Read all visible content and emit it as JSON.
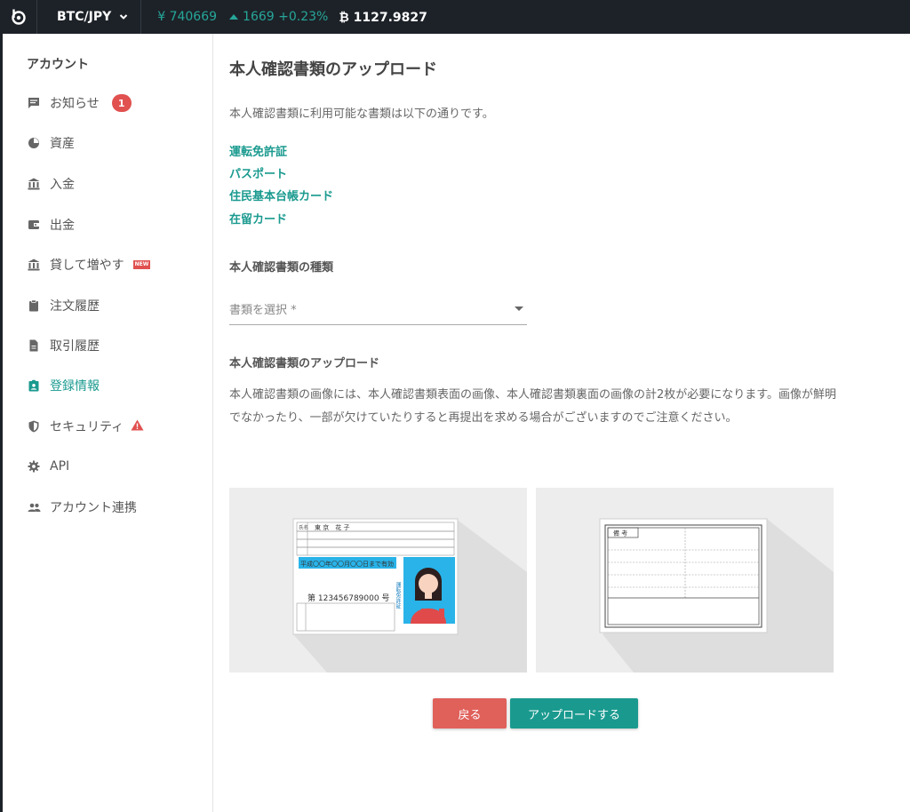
{
  "topbar": {
    "pair": "BTC/JPY",
    "price": "¥ 740669",
    "change": "1669 +0.23%",
    "volume": "₿ 1127.9827"
  },
  "sidebar": {
    "heading": "アカウント",
    "items": [
      {
        "label": "お知らせ",
        "icon": "message-icon",
        "badge": "1"
      },
      {
        "label": "資産",
        "icon": "pie-chart-icon"
      },
      {
        "label": "入金",
        "icon": "bank-icon"
      },
      {
        "label": "出金",
        "icon": "wallet-icon"
      },
      {
        "label": "貸して増やす",
        "icon": "bank-icon",
        "tag": "NEW"
      },
      {
        "label": "注文履歴",
        "icon": "clipboard-icon"
      },
      {
        "label": "取引履歴",
        "icon": "document-icon"
      },
      {
        "label": "登録情報",
        "icon": "account-badge-icon",
        "active": true
      },
      {
        "label": "セキュリティ",
        "icon": "shield-icon",
        "warning": true
      },
      {
        "label": "API",
        "icon": "gear-icon"
      },
      {
        "label": "アカウント連携",
        "icon": "people-icon"
      }
    ]
  },
  "main": {
    "title": "本人確認書類のアップロード",
    "intro": "本人確認書類に利用可能な書類は以下の通りです。",
    "documents": [
      "運転免許証",
      "パスポート",
      "住民基本台帳カード",
      "在留カード"
    ],
    "type_heading": "本人確認書類の種類",
    "select_placeholder": "書類を選択 *",
    "upload_heading": "本人確認書類のアップロード",
    "description": "本人確認書類の画像には、本人確認書類表面の画像、本人確認書類裏面の画像の計2枚が必要になります。画像が鮮明でなかったり、一部が欠けていたりすると再提出を求める場合がございますのでご注意ください。",
    "card_front": {
      "name_label": "氏名",
      "name": "東 京　花 子",
      "expiry": "平成〇〇年〇〇月〇〇日まで有効",
      "license_side_text": "運転免許証",
      "number": "第 123456789000 号"
    },
    "card_back": {
      "remarks_label": "備 考"
    },
    "back_button": "戻る",
    "upload_button": "アップロードする"
  },
  "colors": {
    "accent": "#1a9a8f",
    "danger": "#e0605a",
    "topbar": "#1d2228"
  }
}
